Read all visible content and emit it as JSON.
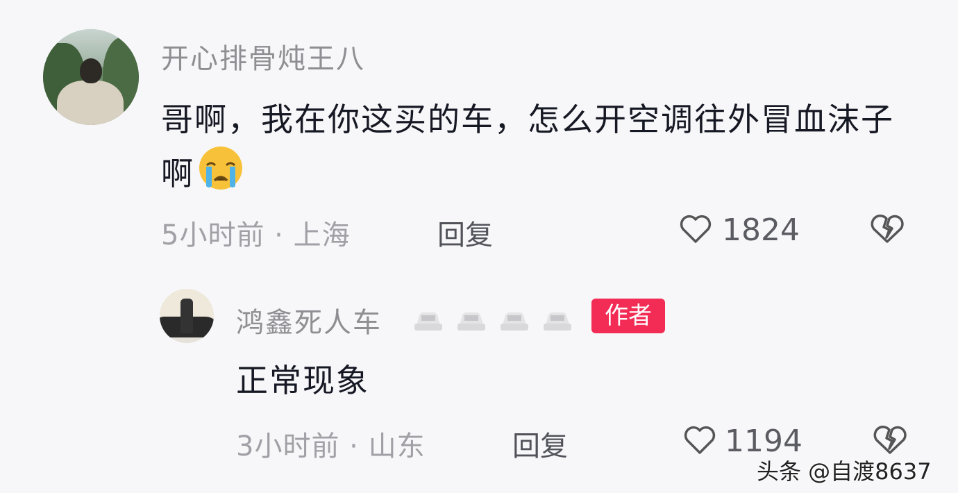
{
  "comments": [
    {
      "username": "开心排骨炖王八",
      "text": "哥啊，我在你这买的车，怎么开空调往外冒血沫子啊",
      "emoji": "loudly-crying-face",
      "time": "5小时前",
      "location": "上海",
      "meta": "5小时前 · 上海",
      "reply_label": "回复",
      "likes": "1824"
    },
    {
      "username": "鸿鑫死人车",
      "username_icons": [
        "car-icon",
        "car-icon",
        "car-icon",
        "car-icon"
      ],
      "badge": "作者",
      "text": "正常现象",
      "time": "3小时前",
      "location": "山东",
      "meta": "3小时前 · 山东",
      "reply_label": "回复",
      "likes": "1194"
    }
  ],
  "watermark": {
    "source": "头条 @自渡8637"
  },
  "colors": {
    "background": "#f7f7f9",
    "username": "#8e8e93",
    "comment_text": "#161823",
    "meta": "#a0a0a6",
    "author_badge": "#f22c55"
  }
}
